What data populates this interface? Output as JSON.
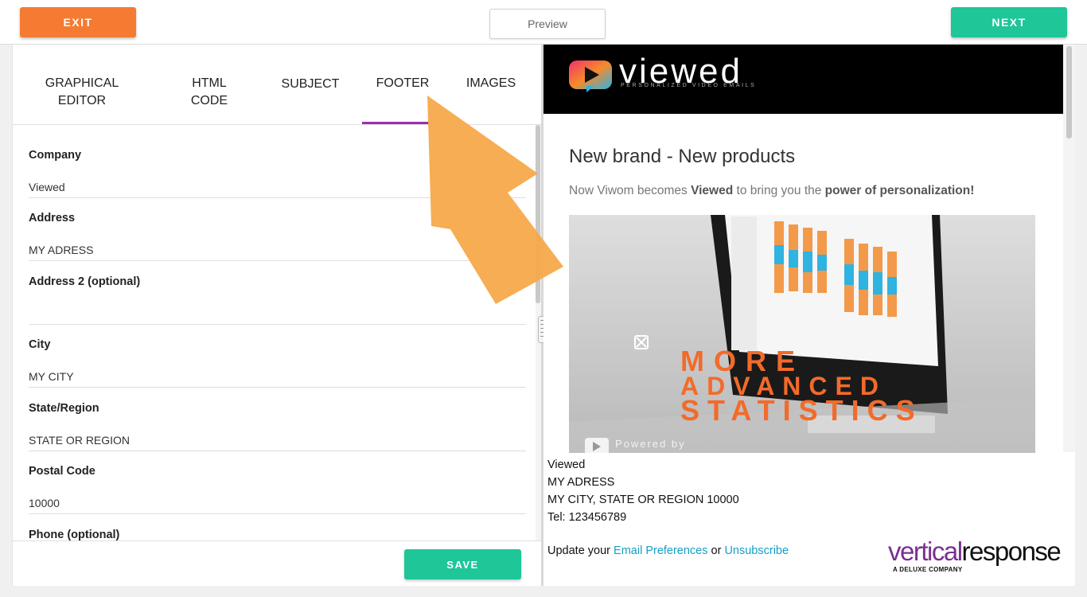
{
  "topbar": {
    "exit_label": "EXIT",
    "preview_label": "Preview",
    "next_label": "NEXT"
  },
  "tabs": {
    "graphical_line1": "GRAPHICAL",
    "graphical_line2": "EDITOR",
    "html_line1": "HTML",
    "html_line2": "CODE",
    "subject": "SUBJECT",
    "footer": "FOOTER",
    "images": "IMAGES",
    "active": "FOOTER"
  },
  "form": {
    "company_label": "Company",
    "company_value": "Viewed",
    "address_label": "Address",
    "address_value": "MY ADRESS",
    "address2_label": "Address 2 (optional)",
    "address2_value": "",
    "city_label": "City",
    "city_value": "MY CITY",
    "state_label": "State/Region",
    "state_value": "STATE OR REGION",
    "postal_label": "Postal Code",
    "postal_value": "10000",
    "phone_label": "Phone (optional)",
    "save_label": "SAVE"
  },
  "preview": {
    "logo_word": "viewed",
    "logo_tagline": "PERSONALIZED VIDEO EMAILS",
    "title": "New brand - New products",
    "subtitle_pre": "Now Viwom becomes ",
    "subtitle_brand": "Viewed",
    "subtitle_mid": " to bring you the ",
    "subtitle_strong": "power of personalization!",
    "hero_line1": "MORE",
    "hero_line2": "ADVANCED",
    "hero_line3": "STATISTICS",
    "hero_watermark": "Powered by",
    "footer_company": "Viewed",
    "footer_address": "MY ADRESS",
    "footer_city_line": "MY CITY, STATE OR REGION 10000",
    "footer_tel": "Tel: 123456789",
    "pref_prefix": "Update your ",
    "pref_link": "Email Preferences",
    "pref_or": " or ",
    "unsubscribe_link": "Unsubscribe"
  },
  "brand_logo": {
    "vertical": "vertical",
    "response": "response",
    "tagline": "A DELUXE COMPANY"
  },
  "colors": {
    "exit": "#f47b31",
    "next": "#1ec698",
    "save": "#1ec698",
    "tab_active_underline": "#9b2fae",
    "link": "#18a0c4",
    "annotation_arrow": "#f7a94a",
    "hero_text": "#f26b2a"
  },
  "icons": {
    "splitter": "drag-handle-icon",
    "hero_close": "close-x-icon",
    "hero_play": "play-icon",
    "annotation": "arrow-pointer-icon"
  }
}
